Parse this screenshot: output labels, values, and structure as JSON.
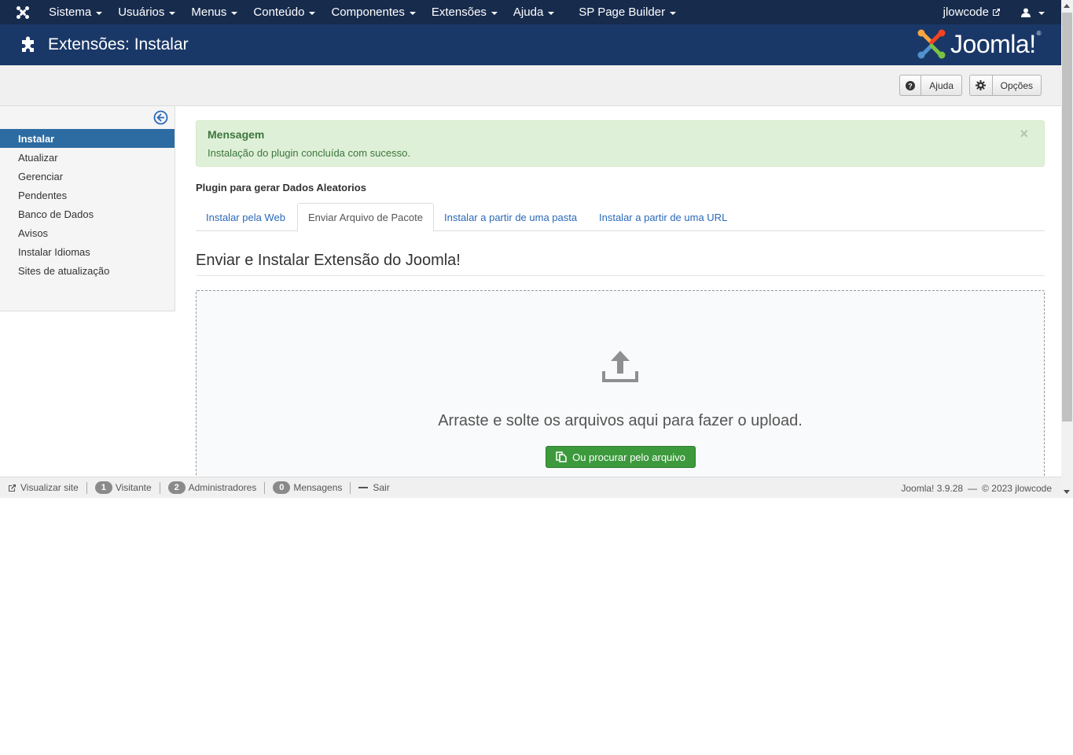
{
  "topnav": {
    "menu": [
      {
        "label": "Sistema",
        "dropdown": true
      },
      {
        "label": "Usuários",
        "dropdown": true
      },
      {
        "label": "Menus",
        "dropdown": true
      },
      {
        "label": "Conteúdo",
        "dropdown": true
      },
      {
        "label": "Componentes",
        "dropdown": true
      },
      {
        "label": "Extensões",
        "dropdown": true
      },
      {
        "label": "Ajuda",
        "dropdown": true
      },
      {
        "label": "SP Page Builder",
        "dropdown": true
      }
    ],
    "user_link": "jlowcode",
    "icons": {
      "brand": "joomla-icon",
      "external": "external-link-icon",
      "user": "user-icon"
    }
  },
  "header": {
    "title": "Extensões: Instalar",
    "icon": "puzzle-icon",
    "logo_text": "Joomla!",
    "logo_mark": "®"
  },
  "toolbar": {
    "help_label": "Ajuda",
    "options_label": "Opções",
    "help_icon": "question-icon",
    "options_icon": "gear-icon"
  },
  "sidebar": {
    "collapse_icon": "arrow-circle-left-icon",
    "items": [
      {
        "label": "Instalar",
        "active": true
      },
      {
        "label": "Atualizar",
        "active": false
      },
      {
        "label": "Gerenciar",
        "active": false
      },
      {
        "label": "Pendentes",
        "active": false
      },
      {
        "label": "Banco de Dados",
        "active": false
      },
      {
        "label": "Avisos",
        "active": false
      },
      {
        "label": "Instalar Idiomas",
        "active": false
      },
      {
        "label": "Sites de atualização",
        "active": false
      }
    ]
  },
  "alert": {
    "title": "Mensagem",
    "message": "Instalação do plugin concluída com sucesso.",
    "close": "×",
    "color": "#dff0d8"
  },
  "main": {
    "subtitle": "Plugin para gerar Dados Aleatorios",
    "tabs": [
      {
        "label": "Instalar pela Web",
        "active": false
      },
      {
        "label": "Enviar Arquivo de Pacote",
        "active": true
      },
      {
        "label": "Instalar a partir de uma pasta",
        "active": false
      },
      {
        "label": "Instalar a partir de uma URL",
        "active": false
      }
    ],
    "section_title": "Enviar e Instalar Extensão do Joomla!",
    "dropzone": {
      "icon": "upload-icon",
      "text": "Arraste e solte os arquivos aqui para fazer o upload.",
      "button_label": "Ou procurar pelo arquivo",
      "button_icon": "copy-icon",
      "button_color": "#3c9a3c"
    }
  },
  "statusbar": {
    "view_site": "Visualizar site",
    "visitors_count": "1",
    "visitors_label": "Visitante",
    "admins_count": "2",
    "admins_label": "Administradores",
    "messages_count": "0",
    "messages_label": "Mensagens",
    "logout": "Sair",
    "version": "Joomla! 3.9.28",
    "em_dash": "—",
    "copyright": "© 2023 jlowcode"
  },
  "colors": {
    "nav_bg": "#172b4d",
    "header_bg": "#1a3867",
    "sidebar_active": "#2d6ca2",
    "link": "#2a69b8"
  }
}
